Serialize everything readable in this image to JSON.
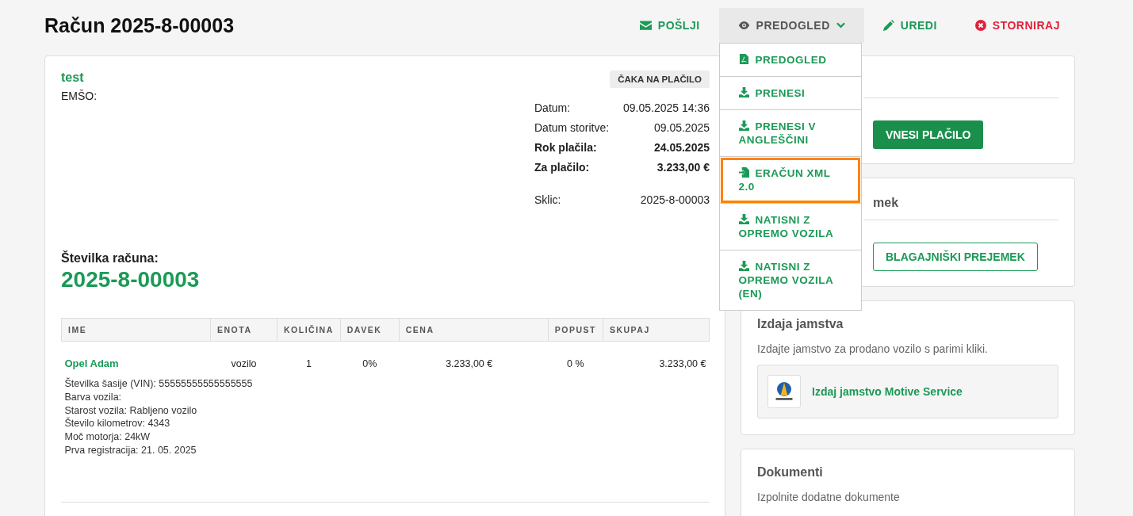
{
  "header": {
    "title": "Račun 2025-8-00003",
    "actions": [
      {
        "kind": "send",
        "label": "POŠLJI",
        "expanded": false
      },
      {
        "kind": "preview",
        "label": "PREDOGLED",
        "expanded": true
      },
      {
        "kind": "edit",
        "label": "UREDI",
        "expanded": false
      },
      {
        "kind": "cancel",
        "label": "STORNIRAJ",
        "expanded": false
      }
    ]
  },
  "dropdown": {
    "items": [
      {
        "kind": "pdf",
        "label": "PREDOGLED",
        "focused": false
      },
      {
        "kind": "download",
        "label": "PRENESI",
        "focused": false
      },
      {
        "kind": "download",
        "label": "PRENESI V ANGLEŠČINI",
        "focused": false
      },
      {
        "kind": "import",
        "label": "ERAČUN XML 2.0",
        "focused": true
      },
      {
        "kind": "download",
        "label": "NATISNI Z OPREMO VOZILA",
        "focused": false
      },
      {
        "kind": "download",
        "label": "NATISNI Z OPREMO VOZILA (EN)",
        "focused": false
      }
    ]
  },
  "invoice": {
    "customer": "test",
    "emso": "EMŠO:",
    "status": "ČAKA NA PLAČILO",
    "meta": [
      {
        "label": "Datum:",
        "value": "09.05.2025 14:36",
        "bold": false
      },
      {
        "label": "Datum storitve:",
        "value": "09.05.2025",
        "bold": false
      },
      {
        "label": "Rok plačila:",
        "value": "24.05.2025",
        "bold": true
      },
      {
        "label": "Za plačilo:",
        "value": "3.233,00 €",
        "bold": true
      }
    ],
    "reference": {
      "label": "Sklic:",
      "value": "2025-8-00003"
    },
    "number_label": "Številka računa:",
    "number": "2025-8-00003",
    "table": {
      "columns": [
        "IME",
        "ENOTA",
        "KOLIČINA",
        "DAVEK",
        "CENA",
        "POPUST",
        "SKUPAJ"
      ],
      "rows": [
        {
          "name": "Opel Adam",
          "unit": "vozilo",
          "quantity": "1",
          "tax": "0%",
          "price": "3.233,00 €",
          "discount": "0 %",
          "total": "3.233,00 €",
          "details": [
            "Številka šasije (VIN): 55555555555555555",
            "Barva vozila:",
            "Starost vozila: Rabljeno vozilo",
            "Število kilometrov: 4343",
            "Moč motorja: 24kW",
            "Prva registracija: 21. 05. 2025"
          ]
        }
      ]
    }
  },
  "sidebar": {
    "payment_button": "VNESI PLAČILO",
    "receipt_title": "mek",
    "receipt_button": "BLAGAJNIŠKI PREJEMEK",
    "warranty": {
      "title": "Izdaja jamstva",
      "text": "Izdajte jamstvo za prodano vozilo s parimi kliki.",
      "link": "Izdaj jamstvo Motive Service"
    },
    "documents": {
      "title": "Dokumenti",
      "text": "Izpolnite dodatne dokumente"
    }
  }
}
